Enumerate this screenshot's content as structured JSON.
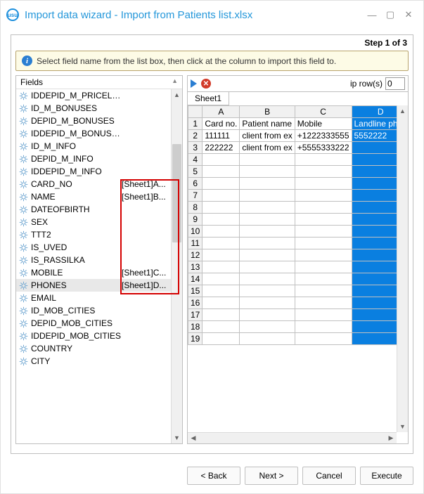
{
  "window": {
    "title": "Import data wizard - Import from Patients list.xlsx",
    "app_icon_text": "usu"
  },
  "step_label": "Step 1 of 3",
  "hint_text": "Select field name from the list box, then click at the column to import this field to.",
  "fields": {
    "header_label": "Fields",
    "header_up_arrow": "▲",
    "items": [
      {
        "label": "IDDEPID_M_PRICELIST",
        "map": ""
      },
      {
        "label": "ID_M_BONUSES",
        "map": ""
      },
      {
        "label": "DEPID_M_BONUSES",
        "map": ""
      },
      {
        "label": "IDDEPID_M_BONUSES",
        "map": ""
      },
      {
        "label": "ID_M_INFO",
        "map": ""
      },
      {
        "label": "DEPID_M_INFO",
        "map": ""
      },
      {
        "label": "IDDEPID_M_INFO",
        "map": ""
      },
      {
        "label": "CARD_NO",
        "map": "[Sheet1]A..."
      },
      {
        "label": "NAME",
        "map": "[Sheet1]B..."
      },
      {
        "label": "DATEOFBIRTH",
        "map": ""
      },
      {
        "label": "SEX",
        "map": ""
      },
      {
        "label": "TTT2",
        "map": ""
      },
      {
        "label": "IS_UVED",
        "map": ""
      },
      {
        "label": "IS_RASSILKA",
        "map": ""
      },
      {
        "label": "MOBILE",
        "map": "[Sheet1]C..."
      },
      {
        "label": "PHONES",
        "map": "[Sheet1]D...",
        "selected": true
      },
      {
        "label": "EMAIL",
        "map": ""
      },
      {
        "label": "ID_MOB_CITIES",
        "map": ""
      },
      {
        "label": "DEPID_MOB_CITIES",
        "map": ""
      },
      {
        "label": "IDDEPID_MOB_CITIES",
        "map": ""
      },
      {
        "label": "COUNTRY",
        "map": ""
      },
      {
        "label": "CITY",
        "map": ""
      }
    ]
  },
  "skip": {
    "label": "ip row(s)",
    "value": "0"
  },
  "sheet_tab": "Sheet1",
  "spreadsheet": {
    "col_labels": [
      "A",
      "B",
      "C",
      "D"
    ],
    "selected_col_index": 3,
    "row_count": 19,
    "rows": [
      [
        "Card no.",
        "Patient name",
        "Mobile",
        "Landline phon"
      ],
      [
        "111111",
        "client from ex",
        "+1222333555",
        "5552222"
      ],
      [
        "222222",
        "client from ex",
        "+5555333222",
        ""
      ]
    ]
  },
  "buttons": {
    "back": "< Back",
    "next": "Next >",
    "cancel": "Cancel",
    "execute": "Execute"
  }
}
